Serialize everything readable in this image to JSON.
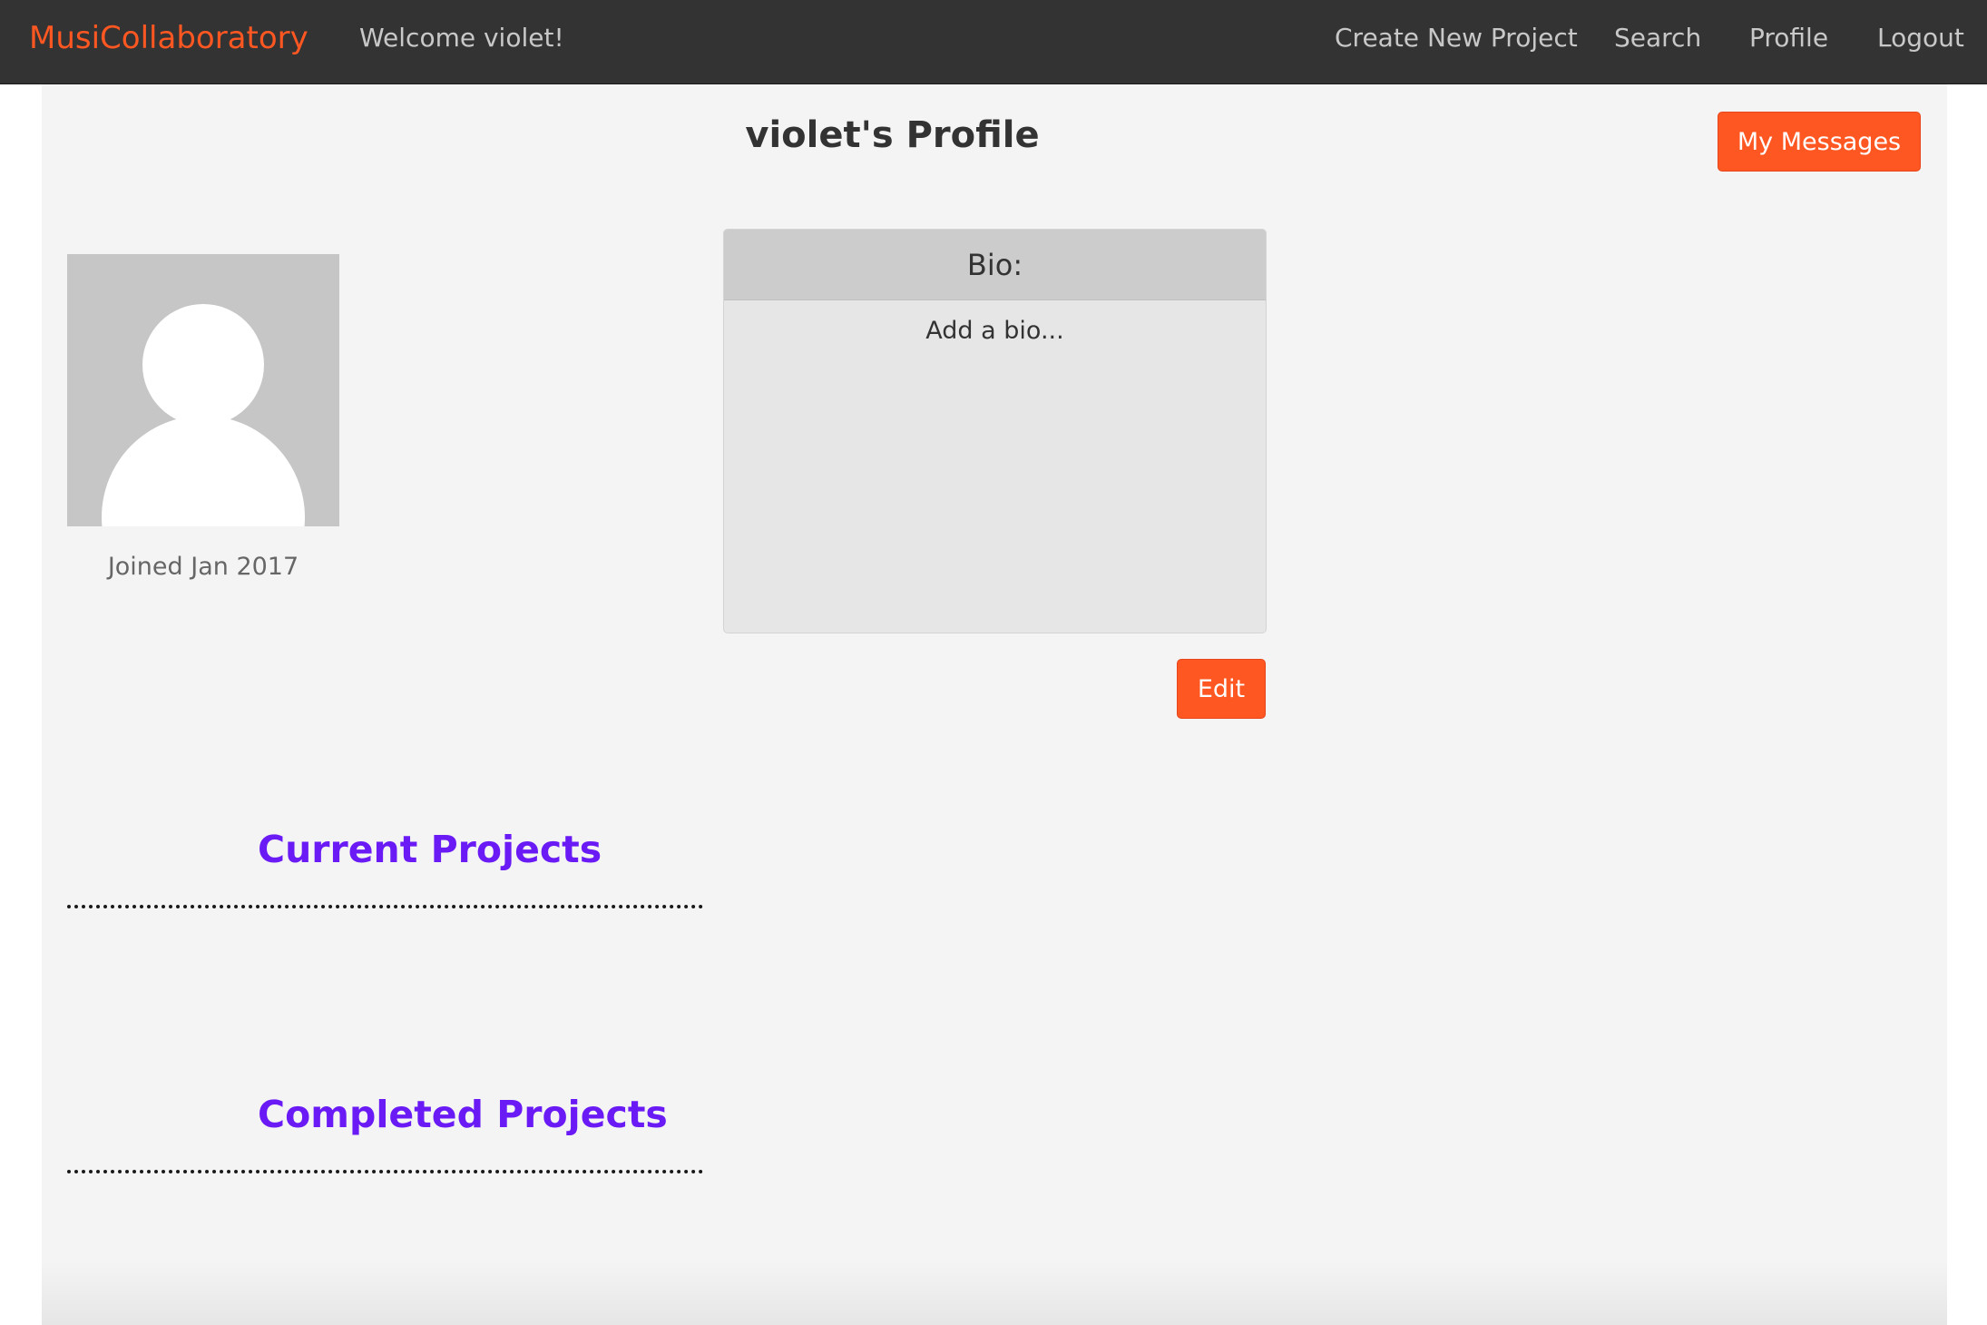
{
  "colors": {
    "navbar_bg": "#333333",
    "brand": "#ff5722",
    "nav_text": "#c8c8c8",
    "accent_button": "#ff5722",
    "button_text": "#ffffff",
    "section_heading": "#6a1bf5",
    "page_bg": "#f4f4f4",
    "muted_text": "#666666"
  },
  "navbar": {
    "brand": "MusiCollaboratory",
    "welcome": "Welcome violet!",
    "links": [
      "Create New Project",
      "Search",
      "Profile",
      "Logout"
    ]
  },
  "profile": {
    "title": "violet's Profile",
    "messages_button": "My Messages",
    "avatar_icon": "user-placeholder-icon",
    "joined": "Joined Jan 2017",
    "bio": {
      "heading": "Bio:",
      "text": "Add a bio..."
    },
    "edit_button": "Edit"
  },
  "sections": {
    "current_projects": "Current Projects",
    "completed_projects": "Completed Projects"
  }
}
